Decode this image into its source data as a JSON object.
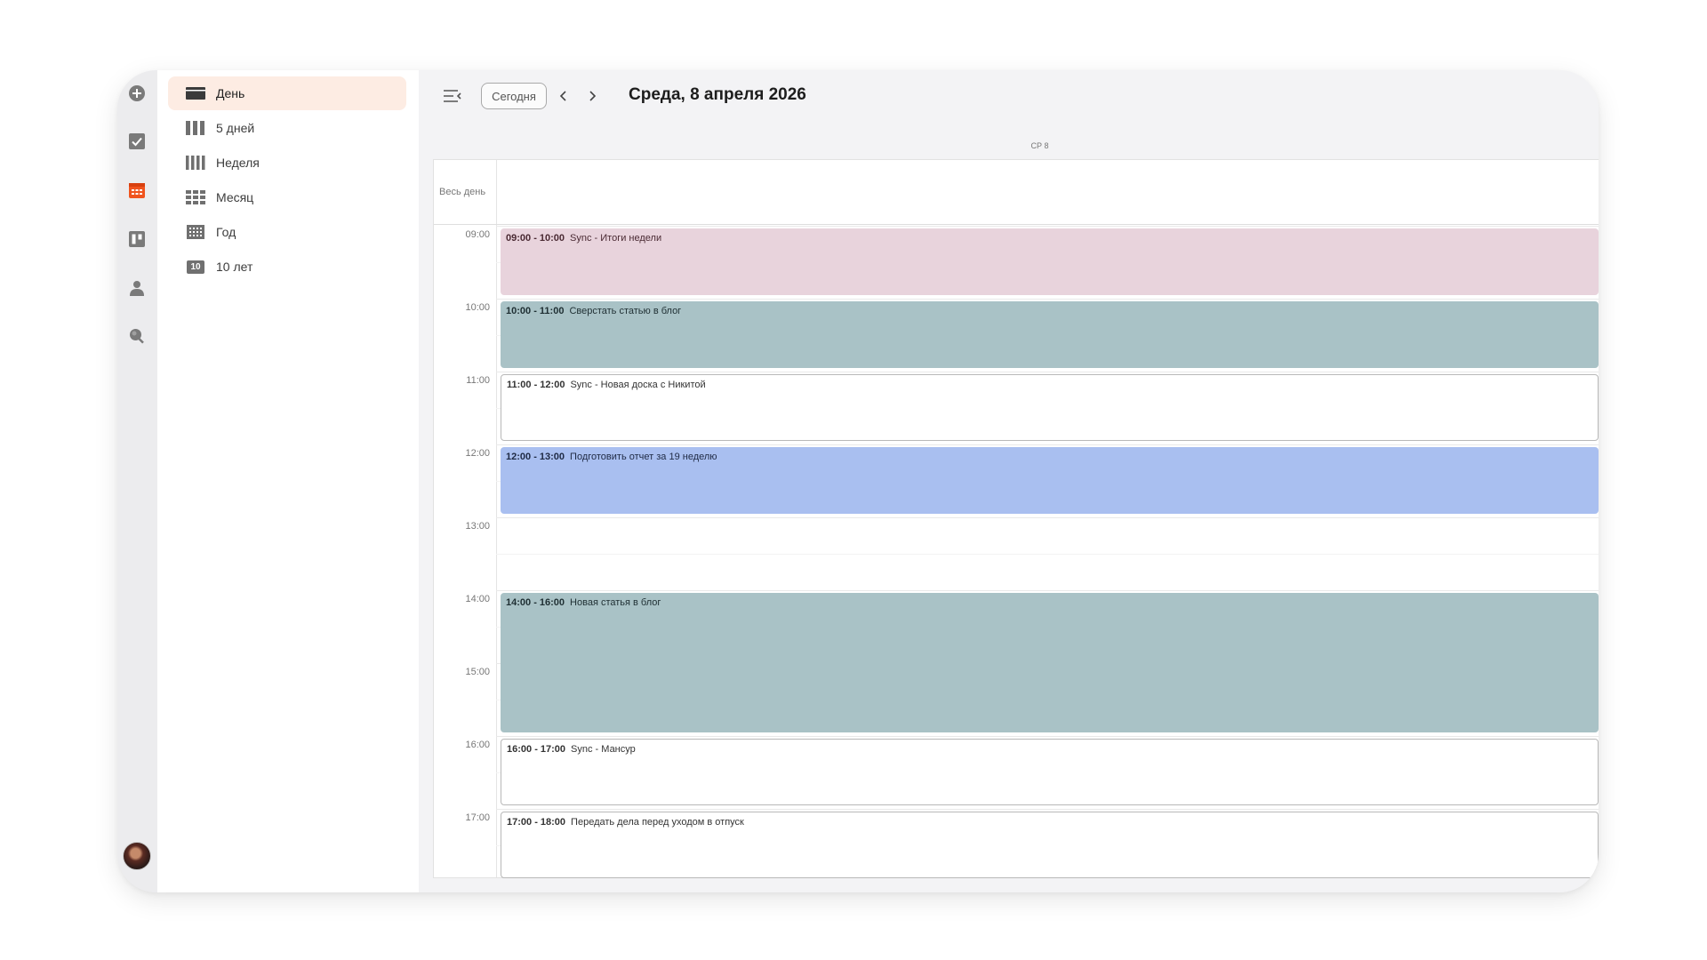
{
  "toolbar": {
    "today_label": "Сегодня",
    "date_title": "Среда, 8 апреля 2026"
  },
  "day_header": "СР 8",
  "all_day_label": "Весь день",
  "views": [
    {
      "label": "День",
      "icon": "day-view-icon",
      "active": true
    },
    {
      "label": "5 дней",
      "icon": "five-days-view-icon",
      "active": false
    },
    {
      "label": "Неделя",
      "icon": "week-view-icon",
      "active": false
    },
    {
      "label": "Месяц",
      "icon": "month-view-icon",
      "active": false
    },
    {
      "label": "Год",
      "icon": "year-view-icon",
      "active": false
    },
    {
      "label": "10 лет",
      "icon": "ten-years-view-icon",
      "badge": "10",
      "active": false
    }
  ],
  "rail": [
    {
      "icon": "add-icon"
    },
    {
      "icon": "tasks-icon"
    },
    {
      "icon": "calendar-icon",
      "active": true
    },
    {
      "icon": "board-icon"
    },
    {
      "icon": "contacts-icon"
    },
    {
      "icon": "search-icon"
    }
  ],
  "hours": [
    "09:00",
    "10:00",
    "11:00",
    "12:00",
    "13:00",
    "14:00",
    "15:00",
    "16:00",
    "17:00"
  ],
  "events": [
    {
      "time": "09:00 - 10:00",
      "title": "Sync - Итоги недели",
      "color": "#e8d3dc",
      "text_color": "#4a2a33"
    },
    {
      "time": "10:00 - 11:00",
      "title": "Сверстать статью в блог",
      "color": "#a9c2c6",
      "text_color": "#1f2f33"
    },
    {
      "time": "11:00 - 12:00",
      "title": "Sync - Новая доска с Никитой",
      "color": "#ffffff",
      "text_color": "#333333",
      "outline": true
    },
    {
      "time": "12:00 - 13:00",
      "title": "Подготовить отчет за 19 неделю",
      "color": "#a9bff0",
      "text_color": "#1f2a44"
    },
    {
      "time": "14:00 - 16:00",
      "title": "Новая статья в блог",
      "color": "#a9c2c6",
      "text_color": "#1f2f33"
    },
    {
      "time": "16:00 - 17:00",
      "title": "Sync - Мансур",
      "color": "#ffffff",
      "text_color": "#333333",
      "outline": true
    },
    {
      "time": "17:00 - 18:00",
      "title": "Передать дела перед уходом в отпуск",
      "color": "#ffffff",
      "text_color": "#333333",
      "outline": true
    }
  ],
  "colors": {
    "accent": "#f0541e",
    "active_view_bg": "#fdece3"
  }
}
